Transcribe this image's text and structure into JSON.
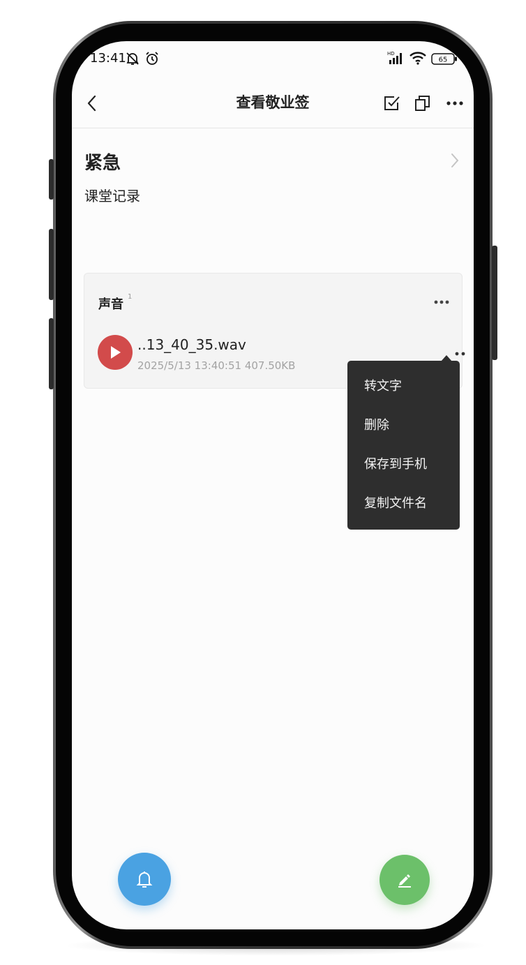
{
  "status_bar": {
    "time": "13:41",
    "battery": "65"
  },
  "header": {
    "title": "查看敬业签"
  },
  "note": {
    "title": "紧急",
    "body": "课堂记录"
  },
  "attachments": {
    "title": "声音",
    "count": "1",
    "file": {
      "name": "..13_40_35.wav",
      "meta": "2025/5/13 13:40:51 407.50KB"
    }
  },
  "context_menu": {
    "items": [
      "转文字",
      "删除",
      "保存到手机",
      "复制文件名"
    ]
  },
  "colors": {
    "play": "#d24b4b",
    "fab_reminder": "#4aa2e2",
    "fab_edit": "#6cc06a",
    "menu_bg": "#2e2e2e"
  },
  "icons": {
    "back": "chevron-left-icon",
    "check": "checkbox-icon",
    "copy": "copy-icon",
    "more": "more-horizontal-icon",
    "bell": "bell-icon",
    "edit": "pencil-icon",
    "play": "play-icon"
  }
}
